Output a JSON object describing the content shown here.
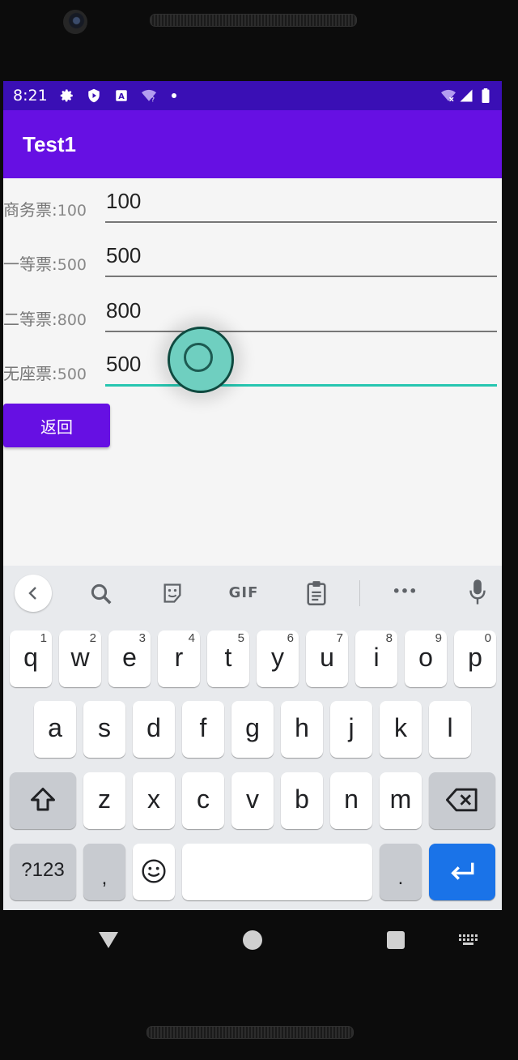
{
  "status_bar": {
    "time": "8:21"
  },
  "app": {
    "title": "Test1"
  },
  "tickets": [
    {
      "label": "商务票:",
      "count": "100",
      "value": "100"
    },
    {
      "label": "一等票:",
      "count": "500",
      "value": "500"
    },
    {
      "label": "二等票:",
      "count": "800",
      "value": "800"
    },
    {
      "label": "无座票:",
      "count": "500",
      "value": "500"
    }
  ],
  "back_button": {
    "label": "返回"
  },
  "keyboard": {
    "toolbar": {
      "gif_label": "GIF",
      "more_label": "•••"
    },
    "row1": [
      {
        "key": "q",
        "hint": "1"
      },
      {
        "key": "w",
        "hint": "2"
      },
      {
        "key": "e",
        "hint": "3"
      },
      {
        "key": "r",
        "hint": "4"
      },
      {
        "key": "t",
        "hint": "5"
      },
      {
        "key": "y",
        "hint": "6"
      },
      {
        "key": "u",
        "hint": "7"
      },
      {
        "key": "i",
        "hint": "8"
      },
      {
        "key": "o",
        "hint": "9"
      },
      {
        "key": "p",
        "hint": "0"
      }
    ],
    "row2": [
      "a",
      "s",
      "d",
      "f",
      "g",
      "h",
      "j",
      "k",
      "l"
    ],
    "row3": [
      "z",
      "x",
      "c",
      "v",
      "b",
      "n",
      "m"
    ],
    "symbols_label": "?123",
    "comma_label": ",",
    "period_label": "."
  },
  "colors": {
    "status_bar": "#3a0fb5",
    "app_bar": "#6610e3",
    "focus_underline": "#26c6b0",
    "enter_key": "#1a73e8"
  },
  "icons": [
    "settings-icon",
    "shield-play-icon",
    "a-box-icon",
    "wifi-question-icon",
    "wifi-x-icon",
    "signal-icon",
    "battery-icon",
    "chevron-left-icon",
    "search-icon",
    "sticker-icon",
    "clipboard-icon",
    "mic-icon",
    "shift-icon",
    "backspace-icon",
    "emoji-icon",
    "enter-icon",
    "nav-back-icon",
    "nav-home-icon",
    "nav-recents-icon",
    "keyboard-icon"
  ]
}
